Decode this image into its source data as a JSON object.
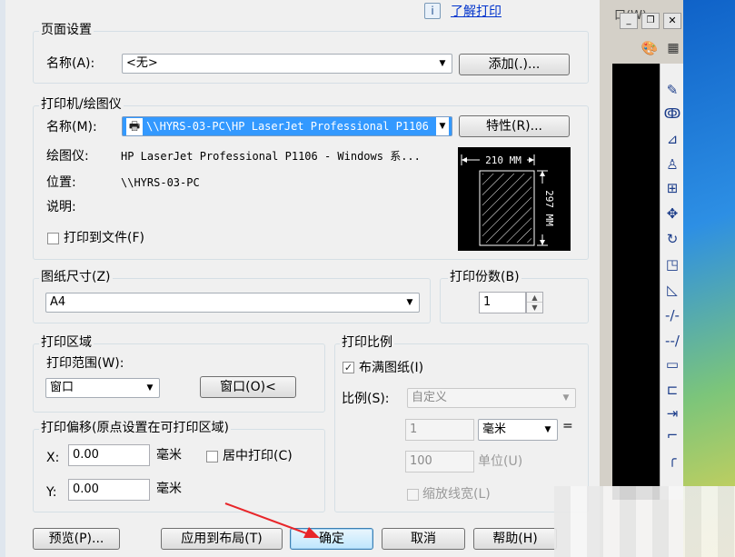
{
  "help": {
    "link": "了解打印",
    "icon": "i"
  },
  "app": {
    "title_fragment": "口(W)"
  },
  "page_setup": {
    "legend": "页面设置",
    "name_label": "名称(A):",
    "name_value": "<无>",
    "add_button": "添加(.)..."
  },
  "printer": {
    "legend": "打印机/绘图仪",
    "name_label": "名称(M):",
    "name_value": "\\\\HYRS-03-PC\\HP LaserJet Professional P1106",
    "properties_button": "特性(R)...",
    "plotter_label": "绘图仪:",
    "plotter_value": "HP LaserJet Professional P1106 - Windows 系...",
    "location_label": "位置:",
    "location_value": "\\\\HYRS-03-PC",
    "desc_label": "说明:",
    "print_to_file_label": "打印到文件(F)",
    "print_to_file_checked": false,
    "preview_width": "210 MM",
    "preview_height": "297 MM"
  },
  "paper_size": {
    "legend": "图纸尺寸(Z)",
    "value": "A4"
  },
  "copies": {
    "legend": "打印份数(B)",
    "value": "1"
  },
  "print_area": {
    "legend": "打印区域",
    "range_label": "打印范围(W):",
    "range_value": "窗口",
    "window_button": "窗口(O)<"
  },
  "print_scale": {
    "legend": "打印比例",
    "fit_label": "布满图纸(I)",
    "fit_checked": true,
    "scale_label": "比例(S):",
    "scale_value": "自定义",
    "value1": "1",
    "unit_value": "毫米",
    "equals": "=",
    "value2": "100",
    "unit_label": "单位(U)",
    "lineweight_label": "缩放线宽(L)",
    "lineweight_checked": false
  },
  "print_offset": {
    "legend": "打印偏移(原点设置在可打印区域)",
    "x_label": "X:",
    "x_value": "0.00",
    "x_unit": "毫米",
    "y_label": "Y:",
    "y_value": "0.00",
    "y_unit": "毫米",
    "center_label": "居中打印(C)",
    "center_checked": false
  },
  "buttons": {
    "preview": "预览(P)...",
    "apply_layout": "应用到布局(T)",
    "ok": "确定",
    "cancel": "取消",
    "help": "帮助(H)"
  },
  "toolbar_icons": [
    "pencil-icon",
    "offset-icon",
    "mirror-icon",
    "stamp-icon",
    "array-icon",
    "move-icon",
    "rotate-icon",
    "scale-icon",
    "stretch-icon",
    "trim-icon",
    "extend-icon",
    "break-icon",
    "join-icon",
    "chamfer-icon",
    "fillet-icon"
  ],
  "colors": {
    "arrow": "#e8262a",
    "link": "#0033cc"
  }
}
